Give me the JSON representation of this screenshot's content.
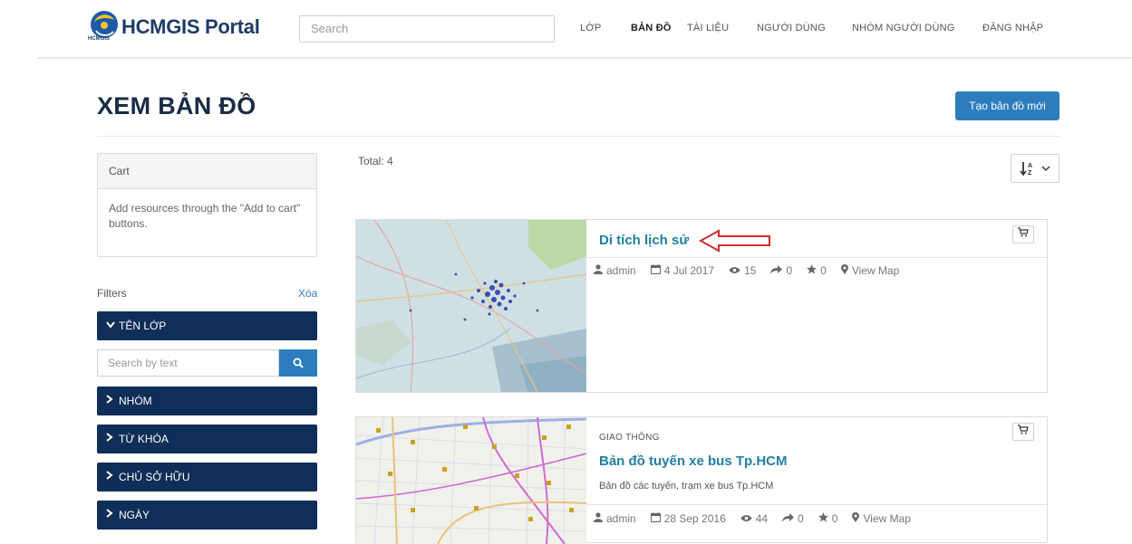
{
  "header": {
    "logo_text": "HCMGIS Portal",
    "logo_small": "HCMGIS",
    "search_placeholder": "Search",
    "nav": [
      "LỚP",
      "BẢN ĐỒ",
      "TÀI LIỆU",
      "NGƯỜI DÙNG",
      "NHÓM NGƯỜI DÙNG",
      "ĐĂNG NHẬP"
    ],
    "active_nav": "BẢN ĐỒ"
  },
  "page": {
    "title": "XEM BẢN ĐỒ",
    "new_map_button": "Tạo bản đồ mới"
  },
  "sidebar": {
    "cart_title": "Cart",
    "cart_body": "Add resources through the \"Add to cart\" buttons.",
    "filters_label": "Filters",
    "clear_label": "Xóa",
    "filter_layer": "TÊN LỚP",
    "search_placeholder": "Search by text",
    "filter_group": "NHÓM",
    "filter_keyword": "TỪ KHÓA",
    "filter_owner": "CHỦ SỞ HỮU",
    "filter_date": "NGÀY"
  },
  "results": {
    "total": "Total: 4",
    "sort_icon": "sort-alpha-icon",
    "items": [
      {
        "title": "Di tích lịch sử",
        "category": "",
        "description": "",
        "owner": "admin",
        "date": "4 Jul 2017",
        "views": "15",
        "shares": "0",
        "rating": "0",
        "view_map": "View Map"
      },
      {
        "title": "Bản đồ tuyến xe bus Tp.HCM",
        "category": "GIAO THÔNG",
        "description": "Bản đồ các tuyến, trạm xe bus Tp.HCM",
        "owner": "admin",
        "date": "28 Sep 2016",
        "views": "44",
        "shares": "0",
        "rating": "0",
        "view_map": "View Map"
      }
    ]
  },
  "colors": {
    "navy": "#0f2e58",
    "accent_blue": "#2d7dbe",
    "title_teal": "#1f7fa0",
    "annotation_red": "#d22b2b"
  }
}
